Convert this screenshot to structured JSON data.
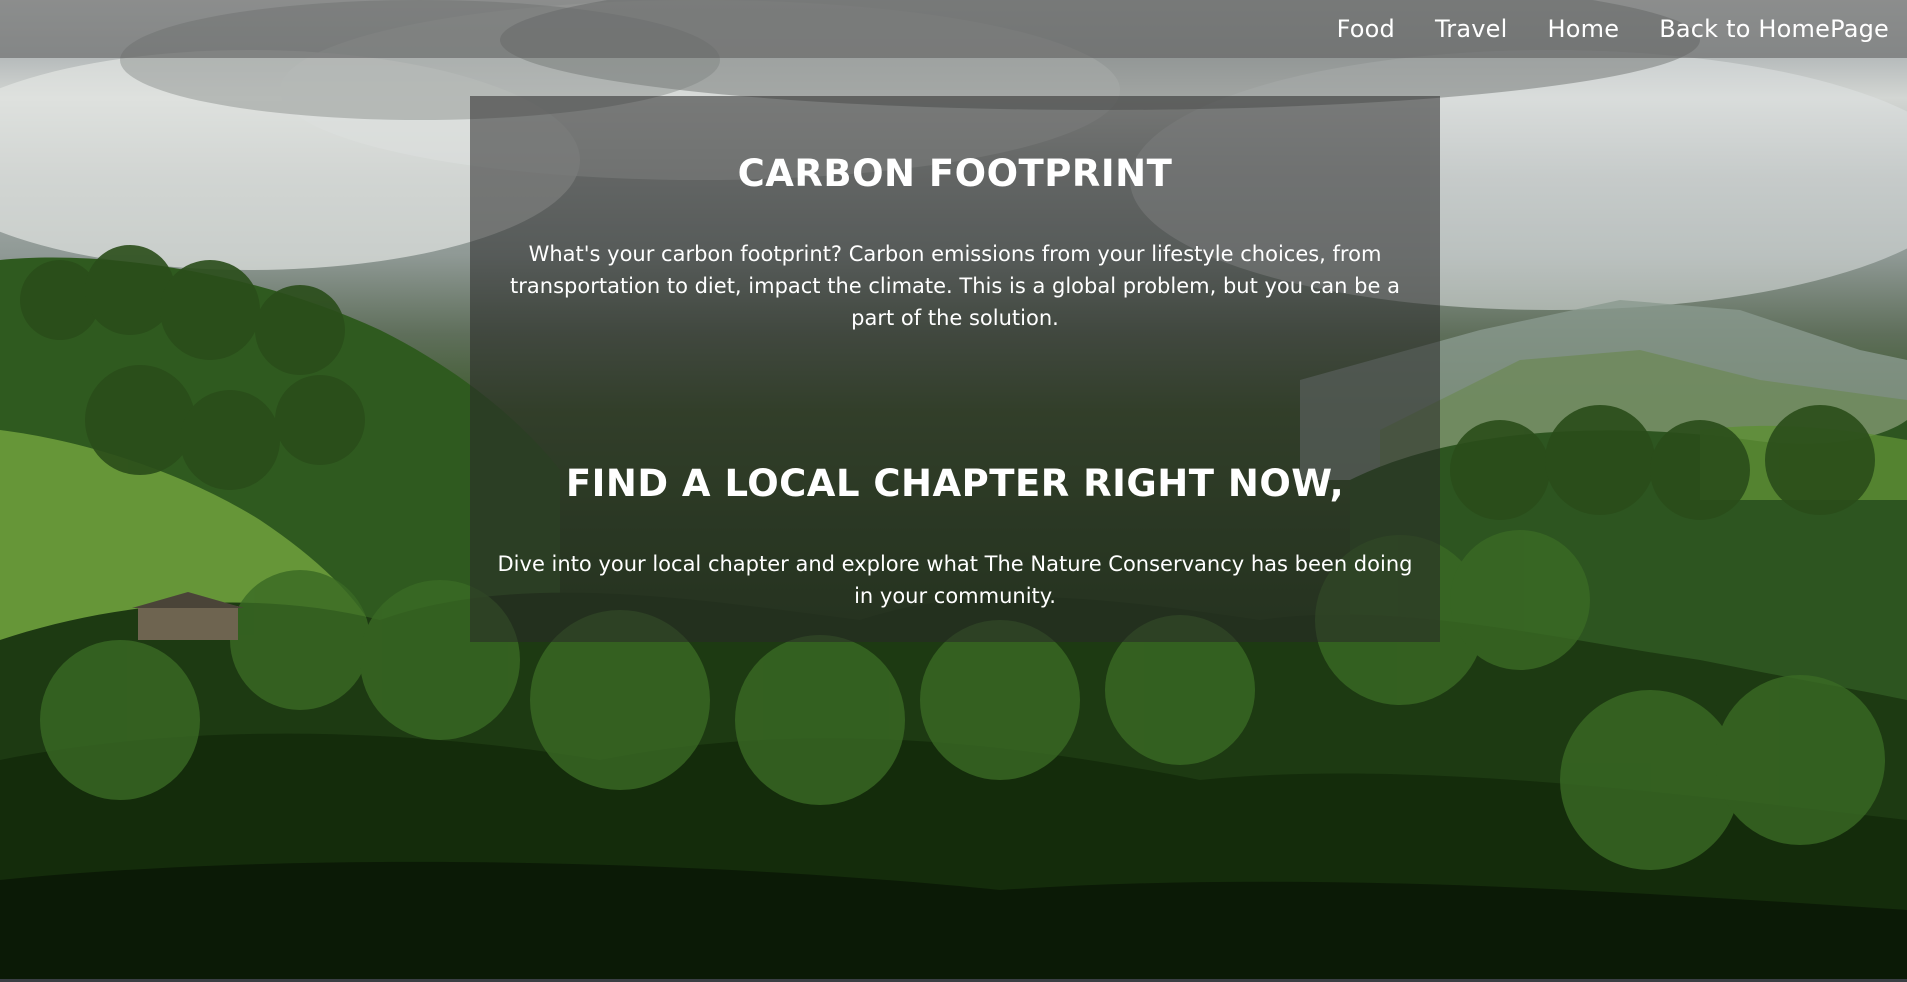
{
  "nav": {
    "items": [
      "Food",
      "Travel",
      "Home",
      "Back to HomePage"
    ]
  },
  "sections": {
    "carbon": {
      "title": "CARBON FOOTPRINT",
      "text": "What's your carbon footprint? Carbon emissions from your lifestyle choices, from transportation to diet, impact the climate. This is a global problem, but you can be a part of the solution."
    },
    "chapter": {
      "title": "FIND A LOCAL CHAPTER RIGHT NOW,",
      "text": "Dive into your local chapter and explore what The Nature Conservancy has been doing in your community."
    }
  },
  "colors": {
    "nav_bg": "#5a5a5a",
    "panel_bg": "#282828",
    "text": "#ffffff",
    "forest_dark": "#14280c",
    "forest_mid": "#2b4a1d",
    "grass": "#6b9a3a",
    "sky": "#c9cdcc"
  }
}
